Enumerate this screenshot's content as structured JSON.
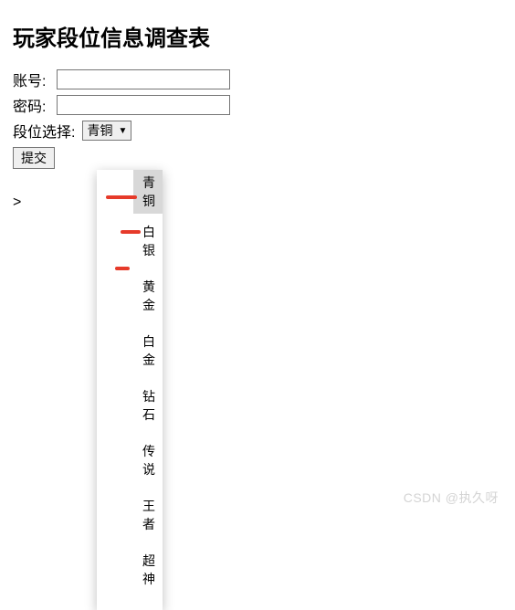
{
  "title": "玩家段位信息调查表",
  "form": {
    "account": {
      "label": "账号:",
      "value": ""
    },
    "password": {
      "label": "密码:",
      "value": ""
    },
    "rank": {
      "label": "段位选择:",
      "selected": "青铜",
      "options": [
        "青铜",
        "白银",
        "黄金",
        "白金",
        "钻石",
        "传说",
        "王者",
        "超神"
      ]
    },
    "submit_label": "提交"
  },
  "prompt": ">",
  "watermark": "CSDN @执久呀"
}
